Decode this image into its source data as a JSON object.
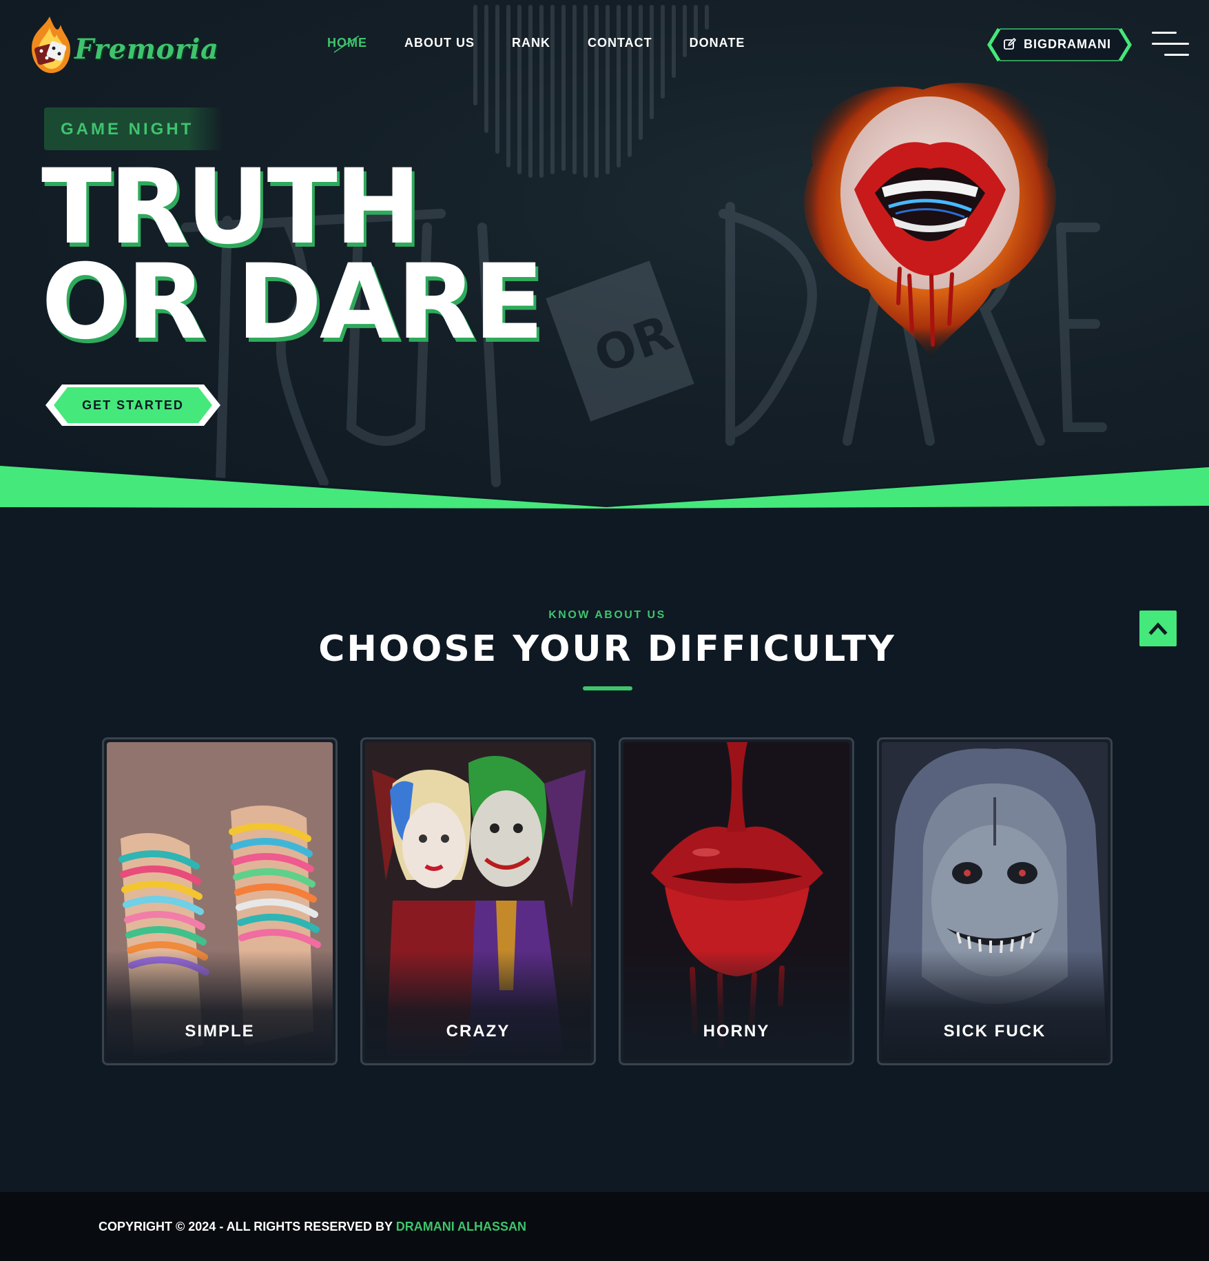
{
  "brand": {
    "name": "Fremoria"
  },
  "nav": {
    "items": [
      {
        "label": "HOME",
        "active": true
      },
      {
        "label": "ABOUT US"
      },
      {
        "label": "RANK"
      },
      {
        "label": "CONTACT"
      },
      {
        "label": "DONATE"
      }
    ]
  },
  "header": {
    "user_button_label": "BIGDRAMANI",
    "user_button_icon": "edit-icon",
    "menu_icon": "hamburger-icon"
  },
  "hero": {
    "tag": "GAME NIGHT",
    "title_line1": "TRUTH",
    "title_line2": "OR DARE",
    "cta_label": "GET STARTED"
  },
  "difficulty": {
    "kicker": "KNOW ABOUT US",
    "title": "CHOOSE YOUR DIFFICULTY",
    "cards": [
      {
        "label": "SIMPLE"
      },
      {
        "label": "CRAZY"
      },
      {
        "label": "HORNY"
      },
      {
        "label": "SICK FUCK"
      }
    ]
  },
  "back_to_top_icon": "chevron-up-icon",
  "footer": {
    "copyright": "COPYRIGHT © 2024 - ALL RIGHTS RESERVED BY ",
    "author": "DRAMANI ALHASSAN"
  },
  "colors": {
    "accent": "#3ec46d",
    "accent_bright": "#45e87a",
    "background": "#0f1923",
    "footer_bg": "#080b0f"
  }
}
